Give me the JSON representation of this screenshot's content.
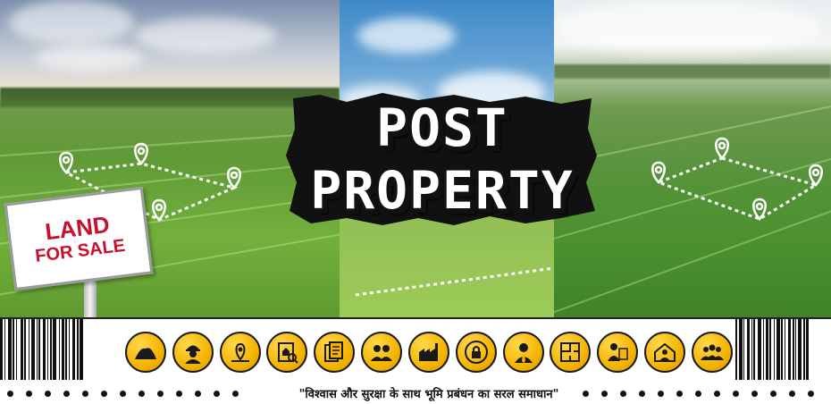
{
  "sign": {
    "line1": "LAND",
    "line2": "FOR SALE"
  },
  "headline": {
    "line1": "POST",
    "line2": "PROPERTY"
  },
  "tagline": "\"विश्वास और सुरक्षा के साथ भूमि प्रबंधन का सरल समाधान\"",
  "colors": {
    "badge_fill": "#f4b400",
    "badge_stroke": "#1a1a1a",
    "sign_text": "#c8102e",
    "plot_line": "#ffffff"
  },
  "icons": [
    "soil-heap-icon",
    "construction-worker-icon",
    "map-pin-icon",
    "property-search-icon",
    "documents-icon",
    "discussion-icon",
    "factory-icon",
    "lock-icon",
    "businessman-icon",
    "floor-plan-icon",
    "agent-document-icon",
    "house-agent-icon",
    "team-icon"
  ]
}
